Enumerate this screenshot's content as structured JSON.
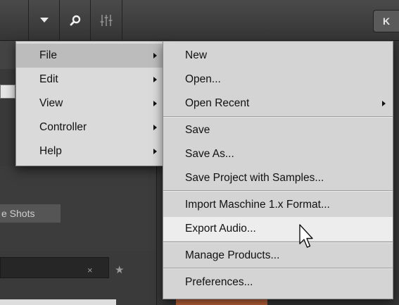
{
  "toolbar": {
    "buttons": [
      {
        "icon": "caret-down-icon"
      },
      {
        "icon": "search-icon"
      },
      {
        "icon": "mixer-sliders-icon"
      }
    ],
    "right_label": "K"
  },
  "background": {
    "chip_label": "e Shots",
    "search_clear": "×",
    "favorite": "★"
  },
  "main_menu": {
    "items": [
      {
        "label": "File",
        "has_submenu": true,
        "highlighted": true
      },
      {
        "label": "Edit",
        "has_submenu": true
      },
      {
        "label": "View",
        "has_submenu": true
      },
      {
        "label": "Controller",
        "has_submenu": true
      },
      {
        "label": "Help",
        "has_submenu": true
      }
    ]
  },
  "file_menu": {
    "items": [
      {
        "label": "New"
      },
      {
        "label": "Open..."
      },
      {
        "label": "Open Recent",
        "has_submenu": true
      },
      {
        "label": "Save"
      },
      {
        "label": "Save As..."
      },
      {
        "label": "Save Project with Samples..."
      },
      {
        "label": "Import Maschine 1.x Format..."
      },
      {
        "label": "Export Audio...",
        "highlighted": true
      },
      {
        "label": "Manage Products..."
      },
      {
        "label": "Preferences..."
      }
    ]
  },
  "colors": {
    "menu_bg": "#d8d8d8",
    "highlight_sub": "#ededed",
    "highlight_main": "#bcbcbc",
    "accent_orange": "#c86a3e"
  }
}
